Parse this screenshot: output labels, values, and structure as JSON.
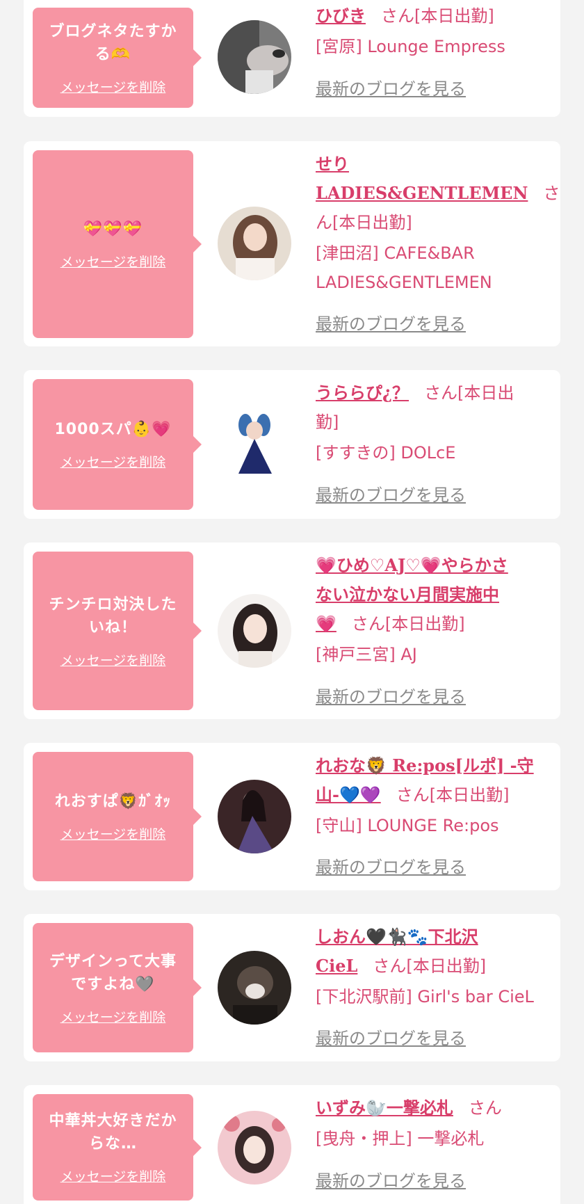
{
  "colors": {
    "background": "#f3f3f3",
    "card": "#ffffff",
    "bubble": "#f795a3",
    "accent": "#d83e6a",
    "muted": "#8a8a8a"
  },
  "items": [
    {
      "message_lines": [
        "ブログネタたすか",
        "る🫶"
      ],
      "delete_label": "メッセージを削除",
      "name": "ひびき",
      "honorific": "さん[本日出勤]",
      "shop_lines": [
        "[宮原] Lounge Empress"
      ],
      "blog_link": "最新のブログを見る"
    },
    {
      "message_lines": [
        "💝💝💝"
      ],
      "delete_label": "メッセージを削除",
      "name": "せり",
      "name_line2": "LADIES&GENTLEMEN",
      "honorific": "さ",
      "honorific_line2": "ん[本日出勤]",
      "shop_lines": [
        "[津田沼] CAFE&BAR",
        "LADIES&GENTLEMEN"
      ],
      "blog_link": "最新のブログを見る"
    },
    {
      "message_lines": [
        "1000スパ👶💗"
      ],
      "delete_label": "メッセージを削除",
      "name": "うららぴ¿？",
      "honorific": "さん[本日出",
      "honorific_line2": "勤]",
      "shop_lines": [
        "[すすきの] DOLcE"
      ],
      "blog_link": "最新のブログを見る"
    },
    {
      "message_lines": [
        "チンチロ対決した",
        "いね！"
      ],
      "delete_label": "メッセージを削除",
      "name": "💗ひめ♡AJ♡💗やらかさ",
      "name_line2": "ない泣かない月間実施中",
      "name_line3": "💗",
      "honorific": "さん[本日出勤]",
      "shop_lines": [
        "[神戸三宮] AJ"
      ],
      "blog_link": "最新のブログを見る"
    },
    {
      "message_lines": [
        "れおすぱ🦁ｶﾞｵｯ"
      ],
      "delete_label": "メッセージを削除",
      "name": "れおな🦁 Re:pos[ルポ] -守",
      "name_line2": "山-💙💜",
      "honorific": "さん[本日出勤]",
      "shop_lines": [
        "[守山] LOUNGE Re:pos"
      ],
      "blog_link": "最新のブログを見る"
    },
    {
      "message_lines": [
        "デザインって大事",
        "ですよね🩶"
      ],
      "delete_label": "メッセージを削除",
      "name": "しおん🖤🐈‍⬛🐾下北沢",
      "name_line2": "CieL",
      "honorific": "さん[本日出勤]",
      "shop_lines": [
        "[下北沢駅前] Girl's bar CieL"
      ],
      "blog_link": "最新のブログを見る"
    },
    {
      "message_lines": [
        "中華丼大好きだか",
        "らな…"
      ],
      "delete_label": "メッセージを削除",
      "name": "いずみ🦭一撃必札",
      "honorific": "さん",
      "shop_lines": [
        "[曳舟・押上] 一撃必札"
      ],
      "blog_link": "最新のブログを見る"
    }
  ]
}
